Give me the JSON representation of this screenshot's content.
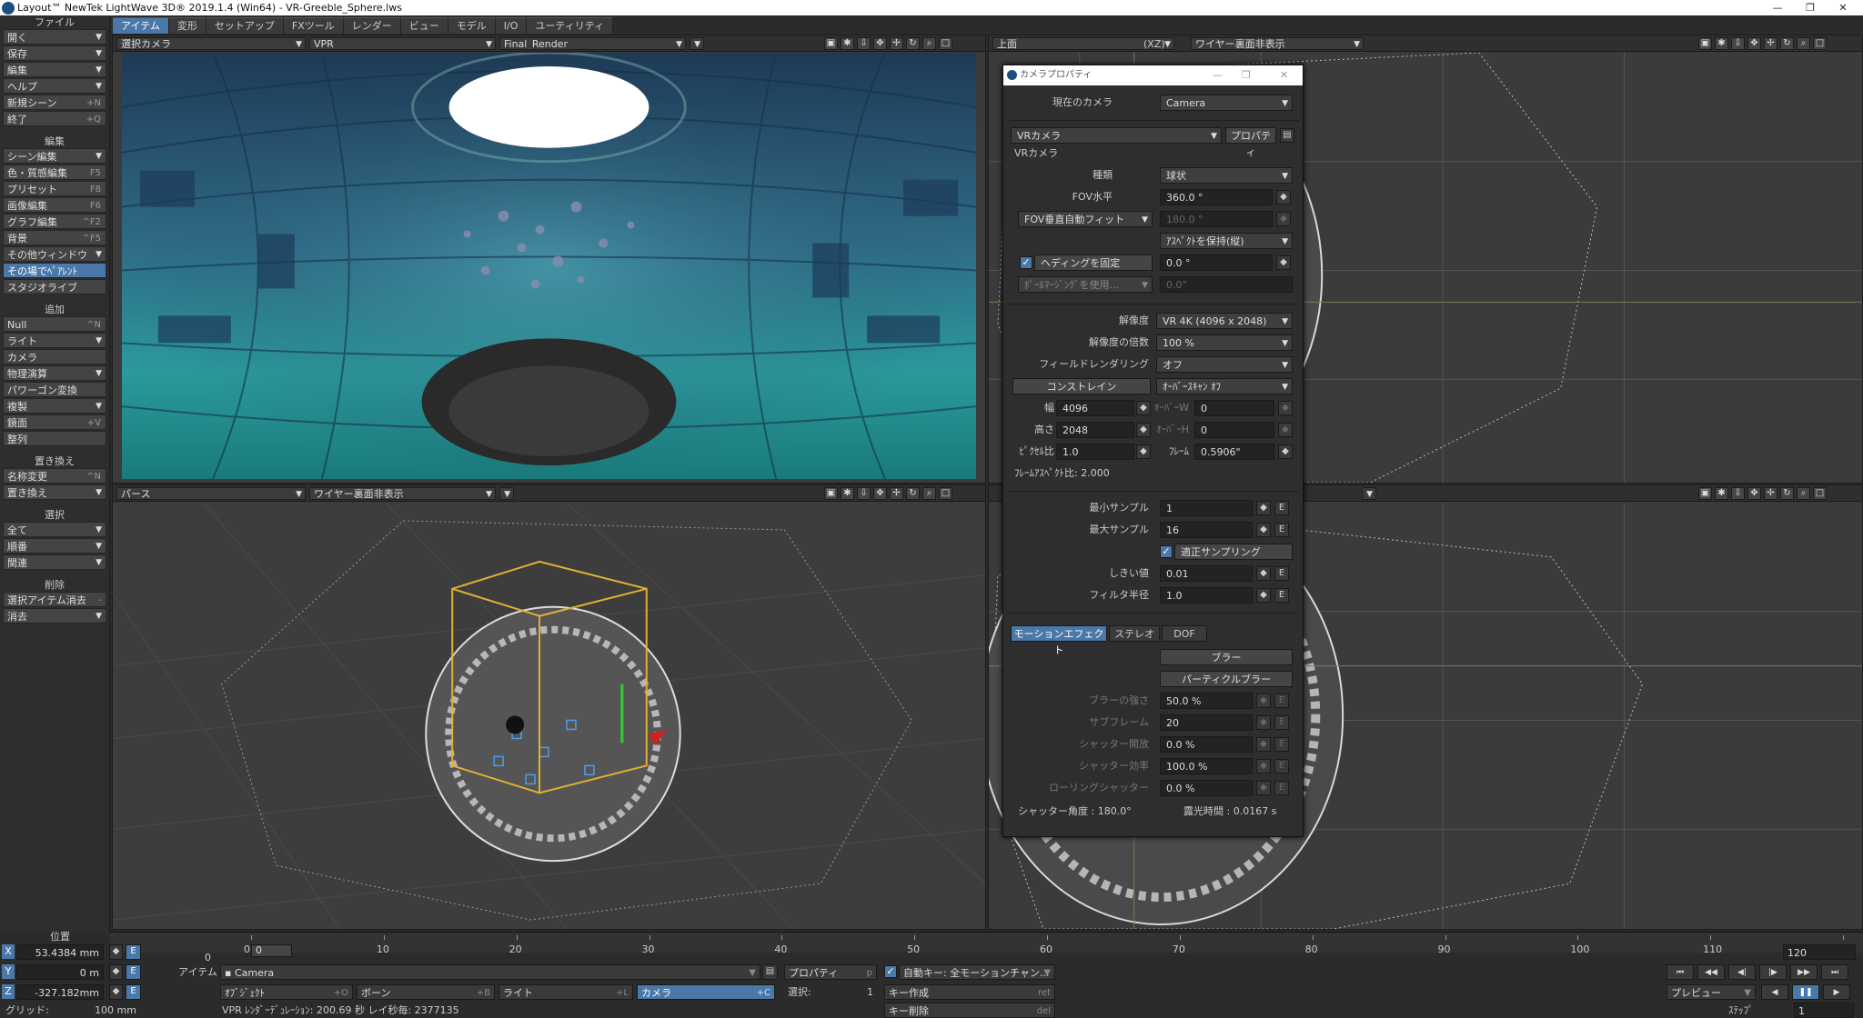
{
  "window": {
    "title": "Layout™ NewTek LightWave 3D® 2019.1.4 (Win64) - VR-Greeble_Sphere.lws",
    "minimize": "—",
    "maximize": "❐",
    "close": "✕"
  },
  "menu_tabs": [
    "アイテム",
    "変形",
    "セットアップ",
    "FXツール",
    "レンダー",
    "ビュー",
    "モデル",
    "I/O",
    "ユーティリティ"
  ],
  "left_panel": {
    "sections": [
      {
        "header": "ファイル",
        "items": [
          {
            "label": "開く",
            "shortcut": "",
            "dropdown": true
          },
          {
            "label": "保存",
            "shortcut": "",
            "dropdown": true
          },
          {
            "label": "編集",
            "shortcut": "",
            "dropdown": true
          },
          {
            "label": "ヘルプ",
            "shortcut": "",
            "dropdown": true
          },
          {
            "label": "新規シーン",
            "shortcut": "+N",
            "dropdown": false
          },
          {
            "label": "終了",
            "shortcut": "+Q",
            "dropdown": false
          }
        ]
      },
      {
        "header": "編集",
        "items": [
          {
            "label": "シーン編集",
            "shortcut": "",
            "dropdown": true
          },
          {
            "label": "色・質感編集",
            "shortcut": "F5",
            "dropdown": false
          },
          {
            "label": "プリセット",
            "shortcut": "F8",
            "dropdown": false
          },
          {
            "label": "画像編集",
            "shortcut": "F6",
            "dropdown": false
          },
          {
            "label": "グラフ編集",
            "shortcut": "^F2",
            "dropdown": false
          },
          {
            "label": "背景",
            "shortcut": "^F5",
            "dropdown": false
          },
          {
            "label": "その他ウィンドウ",
            "shortcut": "",
            "dropdown": true
          },
          {
            "label": "その場でﾍﾟｱﾚﾝﾄ",
            "shortcut": "",
            "dropdown": false,
            "active": true
          },
          {
            "label": "スタジオライブ",
            "shortcut": "",
            "dropdown": false
          }
        ]
      },
      {
        "header": "追加",
        "items": [
          {
            "label": "Null",
            "shortcut": "^N",
            "dropdown": false
          },
          {
            "label": "ライト",
            "shortcut": "",
            "dropdown": true
          },
          {
            "label": "カメラ",
            "shortcut": "",
            "dropdown": false
          },
          {
            "label": "物理演算",
            "shortcut": "",
            "dropdown": true
          },
          {
            "label": "パワーゴン変換",
            "shortcut": "",
            "dropdown": false
          },
          {
            "label": "複製",
            "shortcut": "",
            "dropdown": true
          },
          {
            "label": "鏡面",
            "shortcut": "+V",
            "dropdown": false
          },
          {
            "label": "整列",
            "shortcut": "",
            "dropdown": false
          }
        ]
      },
      {
        "header": "置き換え",
        "items": [
          {
            "label": "名称変更",
            "shortcut": "^N",
            "dropdown": false
          },
          {
            "label": "置き換え",
            "shortcut": "",
            "dropdown": true
          }
        ]
      },
      {
        "header": "選択",
        "items": [
          {
            "label": "全て",
            "shortcut": "",
            "dropdown": true
          },
          {
            "label": "順番",
            "shortcut": "",
            "dropdown": true
          },
          {
            "label": "関連",
            "shortcut": "",
            "dropdown": true
          }
        ]
      },
      {
        "header": "削除",
        "items": [
          {
            "label": "選択アイテム消去",
            "shortcut": "-",
            "dropdown": false
          },
          {
            "label": "消去",
            "shortcut": "",
            "dropdown": true
          }
        ]
      }
    ]
  },
  "viewports": {
    "top_left": {
      "camera": "選択カメラ",
      "mode": "VPR",
      "buffer": "Final_Render"
    },
    "top_right": {
      "view": "上面",
      "axis": "(XZ)",
      "display": "ワイヤー裏面非表示"
    },
    "bottom_left": {
      "view": "パース",
      "display": "ワイヤー裏面非表示"
    }
  },
  "camera_dialog": {
    "title": "カメラプロパティ",
    "current_camera_label": "現在のカメラ",
    "current_camera": "Camera",
    "camera_type": "VRカメラ",
    "properties_btn": "プロパティ",
    "section": "VRカメラ",
    "type_label": "種類",
    "type_value": "球状",
    "fov_h_label": "FOV水平",
    "fov_h": "360.0 °",
    "fov_v_mode": "FOV垂直自動フィット",
    "fov_v": "180.0 °",
    "aspect_mode": "ｱｽﾍﾟｸﾄを保持(縦)",
    "lock_heading": "ヘディングを固定",
    "heading": "0.0 °",
    "pole_merge": "ﾎﾟｰﾙﾏｰｼﾞﾝｸﾞを使用...",
    "pole_value": "0.0°",
    "resolution_label": "解像度",
    "resolution": "VR 4K (4096 x 2048)",
    "multiplier_label": "解像度の倍数",
    "multiplier": "100 %",
    "field_label": "フィールドレンダリング",
    "field": "オフ",
    "constraint_btn": "コンストレイン",
    "overscan": "ｵｰﾊﾞｰｽｷｬﾝ ｵﾌ",
    "width_label": "幅",
    "width": "4096",
    "os_w_label": "ｵｰﾊﾞｰW",
    "os_w": "0",
    "height_label": "高さ",
    "height": "2048",
    "os_h_label": "ｵｰﾊﾞｰH",
    "os_h": "0",
    "pixel_aspect_label": "ﾋﾟｸｾﾙ比",
    "pixel_aspect": "1.0",
    "frame_label": "ﾌﾚｰﾑ",
    "frame": "0.5906\"",
    "frame_aspect": "ﾌﾚｰﾑｱｽﾍﾟｸﾄ比: 2.000",
    "min_samples_label": "最小サンプル",
    "min_samples": "1",
    "max_samples_label": "最大サンプル",
    "max_samples": "16",
    "adaptive": "適正サンプリング",
    "threshold_label": "しきい値",
    "threshold": "0.01",
    "filter_label": "フィルタ半径",
    "filter": "1.0",
    "tabs": [
      "モーションエフェクト",
      "ステレオ",
      "DOF"
    ],
    "blur_btn": "ブラー",
    "particle_blur_btn": "パーティクルブラー",
    "blur_strength_label": "ブラーの強さ",
    "blur_strength": "50.0 %",
    "subframe_label": "サブフレーム",
    "subframe": "20",
    "shutter_open_label": "シャッター開放",
    "shutter_open": "0.0 %",
    "shutter_eff_label": "シャッター効率",
    "shutter_eff": "100.0 %",
    "rolling_label": "ローリングシャッター",
    "rolling": "0.0 %",
    "shutter_angle": "シャッター角度 : 180.0°",
    "exposure": "露光時間 : 0.0167 s",
    "spin_icon": "◆",
    "env_icon": "E"
  },
  "timeline": {
    "ticks": [
      "0",
      "10",
      "20",
      "30",
      "40",
      "50",
      "60",
      "70",
      "80",
      "90",
      "100",
      "110",
      "120"
    ],
    "start": "0",
    "end": "120",
    "current": "0"
  },
  "bottom": {
    "position_label": "位置",
    "x_axis": "X",
    "x": "53.4384 mm",
    "y_axis": "Y",
    "y": "0 m",
    "z_axis": "Z",
    "z": "-327.182mm",
    "grid_label": "グリッド:",
    "grid": "100 mm",
    "item_label": "アイテム",
    "item": "Camera",
    "obj_btn": "ｵﾌﾞｼﾞｪｸﾄ",
    "obj_sc": "+O",
    "bone_btn": "ボーン",
    "bone_sc": "+B",
    "light_btn": "ライト",
    "light_sc": "+L",
    "cam_btn": "カメラ",
    "cam_sc": "+C",
    "props_btn": "プロパティ",
    "props_sc": "p",
    "select_label": "選択:",
    "select_count": "1",
    "autokey": "自動キー: 全モーションチャン...",
    "key_create": "キー作成",
    "key_create_sc": "ret",
    "key_delete": "キー削除",
    "key_delete_sc": "del",
    "status": "VPR ﾚﾝﾀﾞｰﾃﾞｭﾚｰｼｮﾝ: 200.69 秒  レイ秒毎: 2377135",
    "preview": "プレビュー",
    "step_label": "ｽﾃｯﾌﾟ",
    "step": "1"
  }
}
